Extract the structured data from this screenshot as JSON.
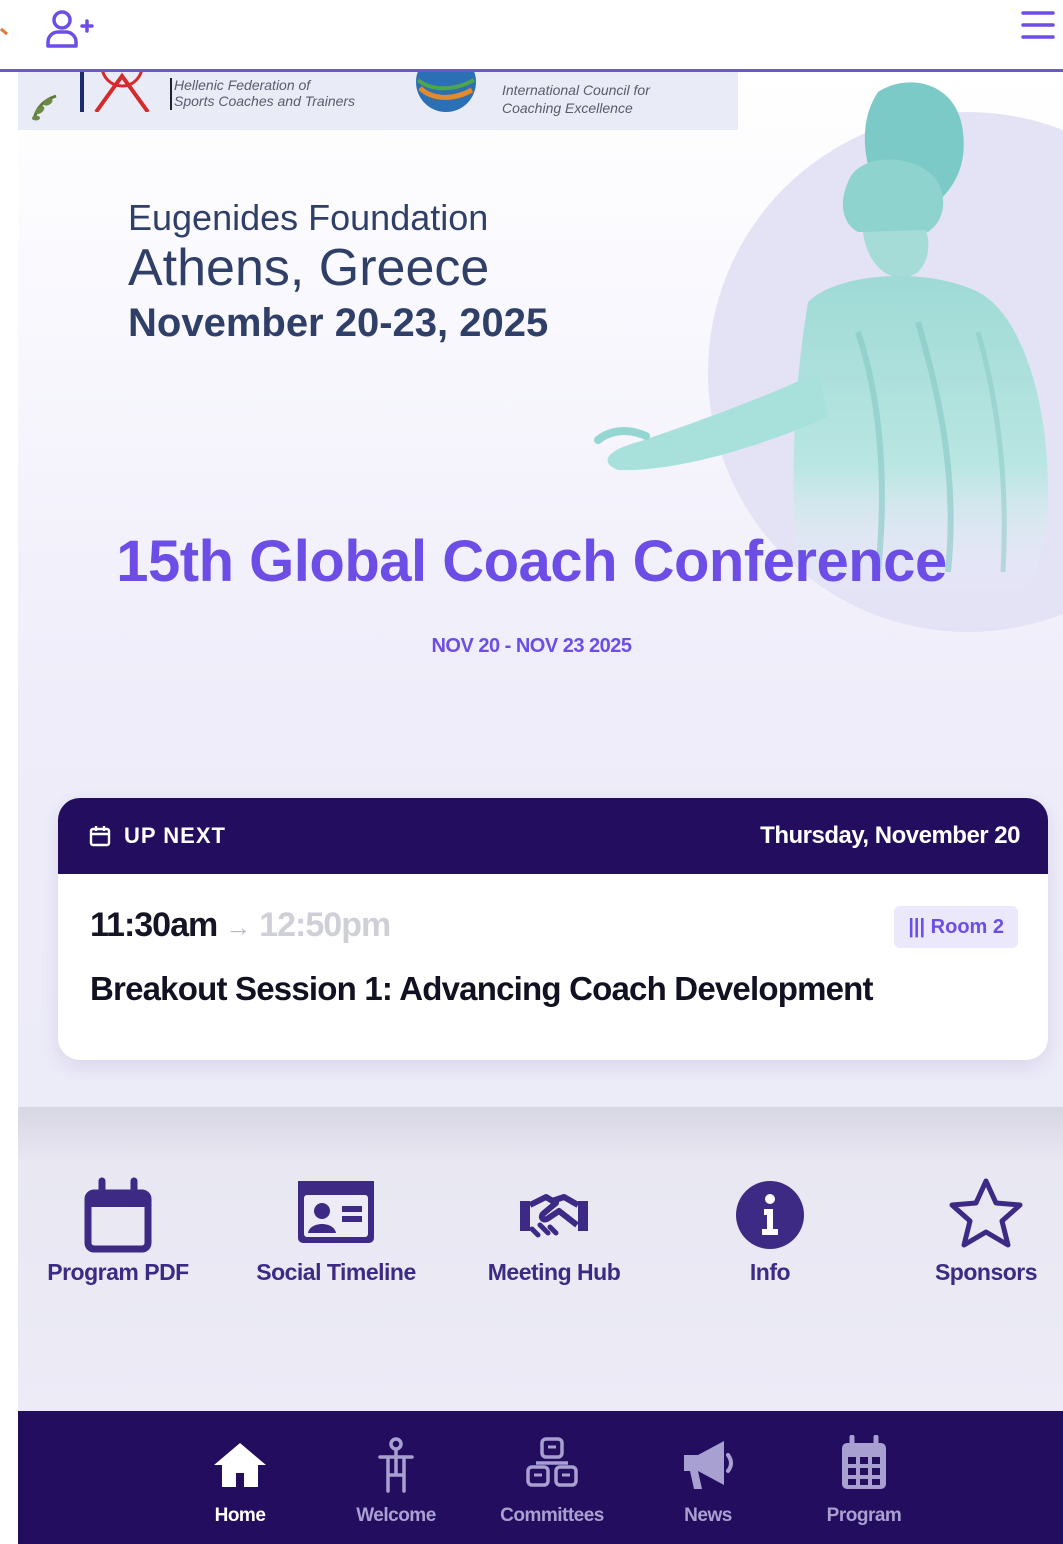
{
  "hero": {
    "logos": {
      "hellenic_federation": "Hellenic Federation of Sports Coaches and Trainers",
      "hellenic_line1": "Hellenic Federation of",
      "hellenic_line2": "Sports Coaches and Trainers",
      "icce_line1": "International Council for",
      "icce_line2": "Coaching Excellence"
    },
    "venue_line1": "Eugenides Foundation",
    "venue_line2": "Athens, Greece",
    "venue_line3": "November 20-23, 2025",
    "conference_title": "15th Global Coach Conference",
    "conference_dates": "NOV 20 - NOV 23 2025"
  },
  "up_next": {
    "label": "UP NEXT",
    "day": "Thursday, November 20",
    "start_time": "11:30am",
    "arrow": "→",
    "end_time": "12:50pm",
    "room": "||| Room 2",
    "session_title": "Breakout Session 1: Advancing Coach Development"
  },
  "quick_links": [
    {
      "label": "Program PDF",
      "icon": "calendar-icon"
    },
    {
      "label": "Social Timeline",
      "icon": "id-card-icon"
    },
    {
      "label": "Meeting Hub",
      "icon": "handshake-icon"
    },
    {
      "label": "Info",
      "icon": "info-icon"
    },
    {
      "label": "Sponsors",
      "icon": "star-icon"
    }
  ],
  "bottom_nav": [
    {
      "label": "Home",
      "icon": "home-icon",
      "active": true
    },
    {
      "label": "Welcome",
      "icon": "person-icon",
      "active": false
    },
    {
      "label": "Committees",
      "icon": "committees-icon",
      "active": false
    },
    {
      "label": "News",
      "icon": "megaphone-icon",
      "active": false
    },
    {
      "label": "Program",
      "icon": "calendar-grid-icon",
      "active": false
    }
  ],
  "colors": {
    "accent": "#6c4ee6",
    "nav_bg": "#230d5e",
    "venue_text": "#2f3f68",
    "link_text": "#3d2a85"
  }
}
